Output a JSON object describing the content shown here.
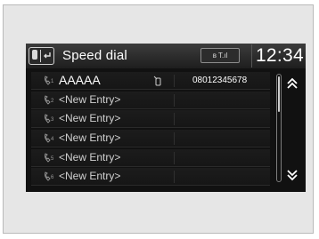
{
  "header": {
    "back_icon": "phone-back-icon",
    "title": "Speed dial",
    "status_icons": "bluetooth-signal-icon",
    "status_text": "ʙ T.ıl",
    "clock": "12:34"
  },
  "entries": [
    {
      "slot": "1",
      "name": "AAAAA",
      "type_icon": "mobile-phone-icon",
      "number": "08012345678"
    },
    {
      "slot": "2",
      "name": "<New Entry>",
      "number": ""
    },
    {
      "slot": "3",
      "name": "<New Entry>",
      "number": ""
    },
    {
      "slot": "4",
      "name": "<New Entry>",
      "number": ""
    },
    {
      "slot": "5",
      "name": "<New Entry>",
      "number": ""
    },
    {
      "slot": "6",
      "name": "<New Entry>",
      "number": ""
    }
  ],
  "scroll": {
    "position_fraction": 0.0
  },
  "colors": {
    "screen_bg": "#111111",
    "text": "#ffffff",
    "frame": "#e6e6e6"
  }
}
